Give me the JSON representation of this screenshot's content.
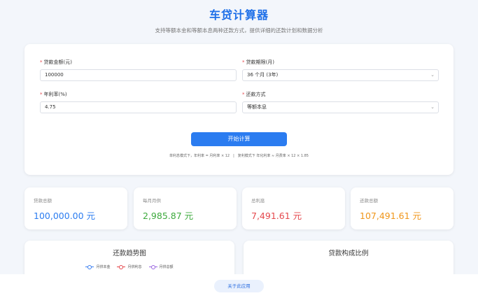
{
  "header": {
    "title": "车贷计算器",
    "subtitle": "支持等额本金和等额本息两种还款方式，提供详细的还款计划和数据分析"
  },
  "form": {
    "loan_amount": {
      "label": "贷款金额(元)",
      "value": "100000"
    },
    "loan_term": {
      "label": "贷款期限(月)",
      "value": "36 个月 (3年)"
    },
    "rate": {
      "label": "年利率(%)",
      "value": "4.75"
    },
    "method": {
      "label": "还款方式",
      "value": "等额本息"
    },
    "submit_label": "开始计算",
    "hint": "单利息模式下，年利率 = 月利率 × 12　|　复利模式下 年化利率 ≈ 月费率 × 12 × 1.85"
  },
  "stats": [
    {
      "label": "贷款总额",
      "value": "100,000.00 元",
      "color": "#2b7cf0"
    },
    {
      "label": "每月月供",
      "value": "2,985.87 元",
      "color": "#3daa3d"
    },
    {
      "label": "总利息",
      "value": "7,491.61 元",
      "color": "#e5484d"
    },
    {
      "label": "还款总额",
      "value": "107,491.61 元",
      "color": "#f0961a"
    }
  ],
  "trend_panel": {
    "title": "还款趋势图",
    "legend": [
      {
        "label": "月供本金",
        "color": "#3a7ef0"
      },
      {
        "label": "月供利息",
        "color": "#e5484d"
      },
      {
        "label": "月供总额",
        "color": "#9a66e0"
      }
    ]
  },
  "composition_panel": {
    "title": "贷款构成比例"
  },
  "footer": {
    "about_label": "关于此应用"
  }
}
